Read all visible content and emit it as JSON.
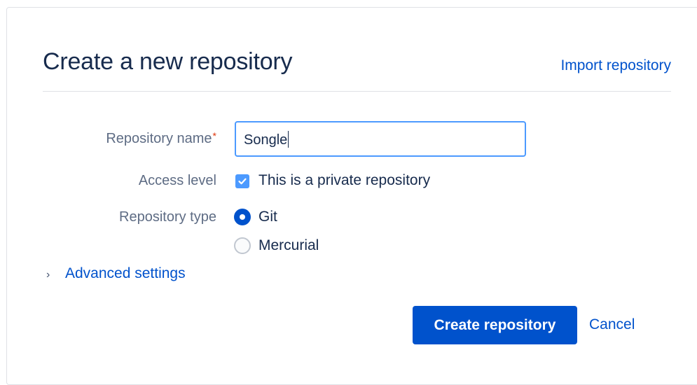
{
  "header": {
    "title": "Create a new repository",
    "import_link": "Import repository"
  },
  "form": {
    "repo_name": {
      "label": "Repository name",
      "required_mark": "*",
      "value": "Songle"
    },
    "access_level": {
      "label": "Access level",
      "checkbox_label": "This is a private repository",
      "checked": true
    },
    "repo_type": {
      "label": "Repository type",
      "options": [
        {
          "label": "Git",
          "selected": true
        },
        {
          "label": "Mercurial",
          "selected": false
        }
      ]
    },
    "advanced_label": "Advanced settings"
  },
  "actions": {
    "create_label": "Create repository",
    "cancel_label": "Cancel"
  },
  "colors": {
    "primary": "#0052CC",
    "focus_border": "#4C9AFF",
    "required": "#DE350B",
    "label": "#5E6C84",
    "text": "#172B4D"
  }
}
